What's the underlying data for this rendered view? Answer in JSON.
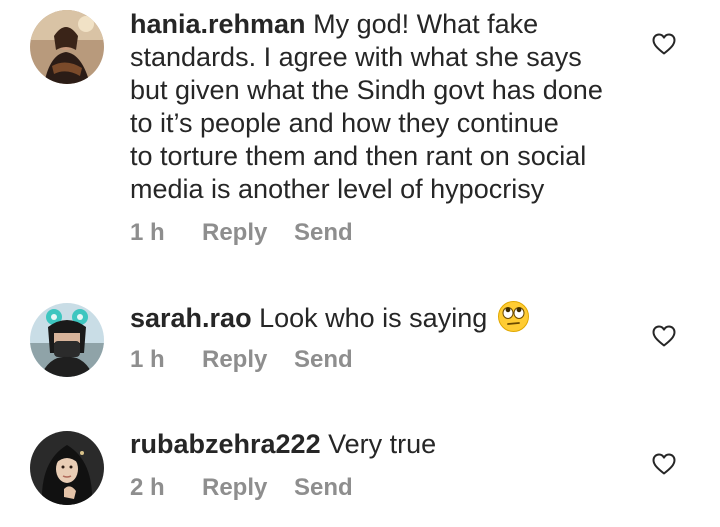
{
  "comments": [
    {
      "username": "hania.rehman",
      "text": "My god! What fake standards. I agree with what she says but given what the Sindh govt has done to it’s people and how they continue to torture them and then rant on social media is another level of hypocrisy",
      "lines": [
        "My god! What fake",
        "standards. I agree with what she says",
        "but given what the Sindh govt has done",
        "to it’s people and how they continue",
        "to torture them and then rant on social",
        "media is another level of hypocrisy"
      ],
      "time": "1 h",
      "reply_label": "Reply",
      "send_label": "Send",
      "like_icon": "heart-outline-icon"
    },
    {
      "username": "sarah.rao",
      "text": "Look who is saying",
      "emoji": "face-with-rolling-eyes",
      "time": "1 h",
      "reply_label": "Reply",
      "send_label": "Send",
      "like_icon": "heart-outline-icon"
    },
    {
      "username": "rubabzehra222",
      "text": "Very true",
      "time": "2 h",
      "reply_label": "Reply",
      "send_label": "Send",
      "like_icon": "heart-outline-icon"
    }
  ],
  "colors": {
    "text": "#262626",
    "secondary_text": "#8e8e8e",
    "background": "#ffffff"
  }
}
